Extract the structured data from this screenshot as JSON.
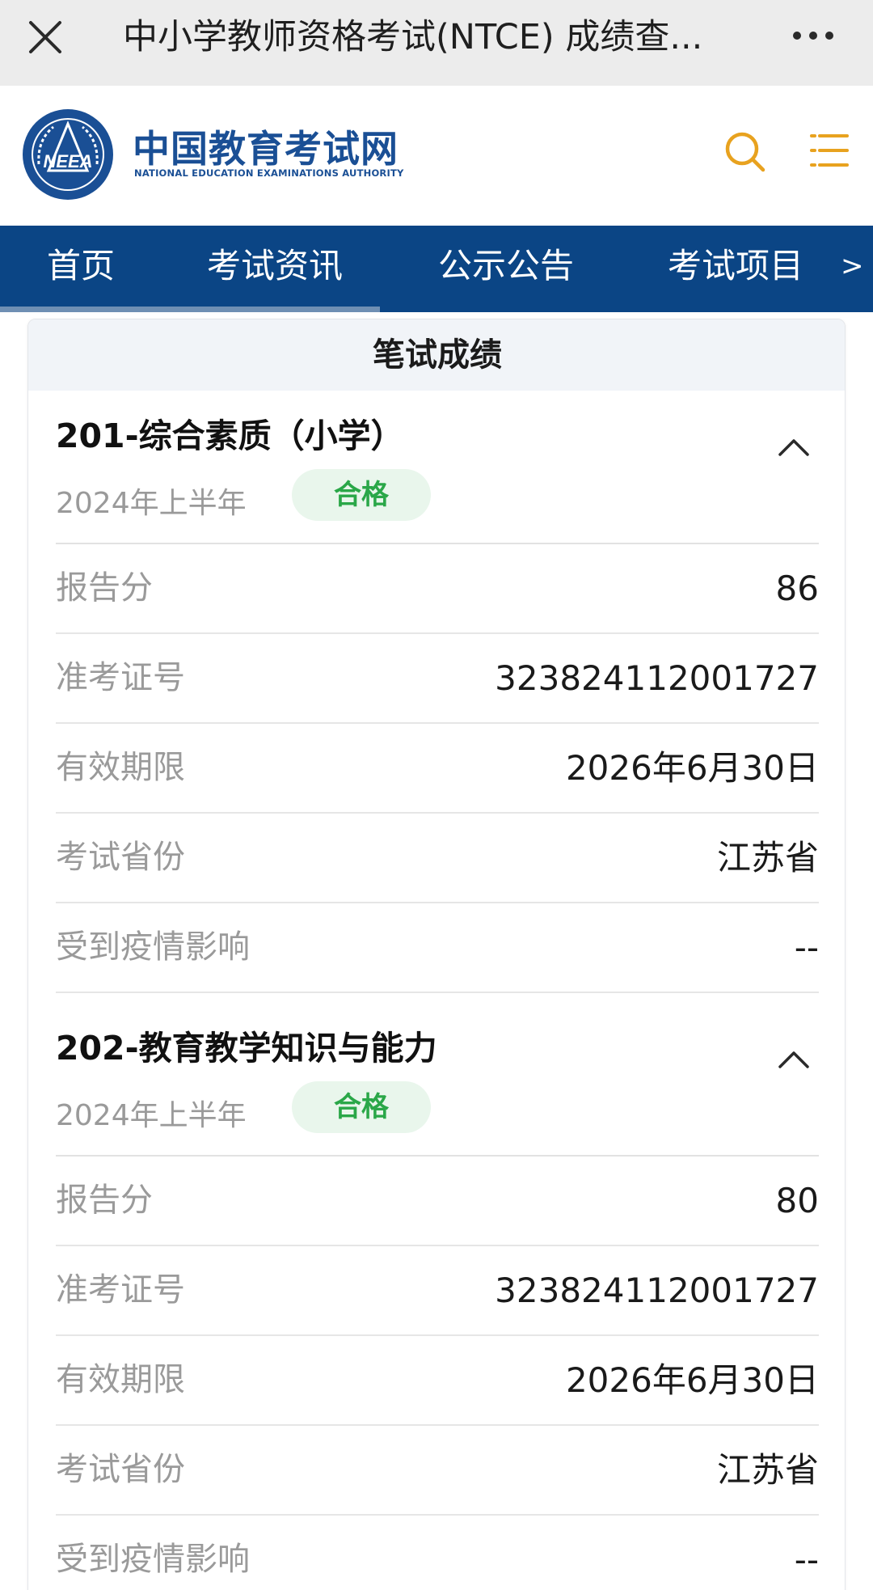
{
  "window": {
    "title": "中小学教师资格考试(NTCE) 成绩查...",
    "close_icon": "close-icon",
    "more_icon": "more-icon"
  },
  "header": {
    "logo_cn": "中国教育考试网",
    "logo_en": "NATIONAL EDUCATION EXAMINATIONS AUTHORITY",
    "seal_text": "NEEA",
    "brand_color": "#1a4f95",
    "accent_color": "#e8a21f"
  },
  "nav": {
    "items": [
      "首页",
      "考试资讯",
      "公示公告",
      "考试项目"
    ],
    "next_label": ">",
    "bg_color": "#0b4585"
  },
  "card": {
    "title": "笔试成绩"
  },
  "subjects": [
    {
      "name": "201-综合素质（小学）",
      "term": "2024年上半年",
      "status": "合格",
      "rows": [
        {
          "label": "报告分",
          "value": "86"
        },
        {
          "label": "准考证号",
          "value": "323824112001727"
        },
        {
          "label": "有效期限",
          "value": "2026年6月30日"
        },
        {
          "label": "考试省份",
          "value": "江苏省"
        },
        {
          "label": "受到疫情影响",
          "value": "--"
        }
      ]
    },
    {
      "name": "202-教育教学知识与能力",
      "term": "2024年上半年",
      "status": "合格",
      "rows": [
        {
          "label": "报告分",
          "value": "80"
        },
        {
          "label": "准考证号",
          "value": "323824112001727"
        },
        {
          "label": "有效期限",
          "value": "2026年6月30日"
        },
        {
          "label": "考试省份",
          "value": "江苏省"
        },
        {
          "label": "受到疫情影响",
          "value": "--"
        }
      ]
    }
  ]
}
